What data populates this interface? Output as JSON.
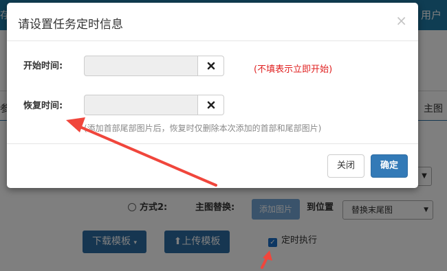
{
  "background": {
    "topbar_left_text": "存各",
    "topbar_user_text": "用户",
    "side_left_text": "参",
    "side_right_text": "主图",
    "method2_label": "方式2:",
    "main_image_replace_label": "主图替换:",
    "add_image_button": "添加图片",
    "to_position_label": "到位置",
    "position_select_value": "替换末尾图",
    "download_template_button": "下载模板",
    "upload_template_button": "上传模板",
    "timed_exec_label": "定时执行"
  },
  "modal": {
    "title": "请设置任务定时信息",
    "close_glyph": "×",
    "start_time": {
      "label": "开始时间:",
      "value": "",
      "placeholder": "",
      "hint": "(不填表示立即开始)"
    },
    "restore_time": {
      "label": "恢复时间:",
      "value": "",
      "placeholder": "",
      "hint": "(添加首部尾部图片后，恢复时仅删除本次添加的首部和尾部图片)"
    },
    "footer": {
      "close_button": "关闭",
      "confirm_button": "确定"
    }
  },
  "colors": {
    "primary": "#337ab7",
    "hint_red": "#e02020",
    "arrow_red": "#f0463c",
    "topbar": "#1f7aa6"
  },
  "icons": {
    "clear": "times-icon",
    "dropdown": "caret-down-icon",
    "upload": "circle-arrow-up-icon",
    "check": "checkmark-icon"
  }
}
